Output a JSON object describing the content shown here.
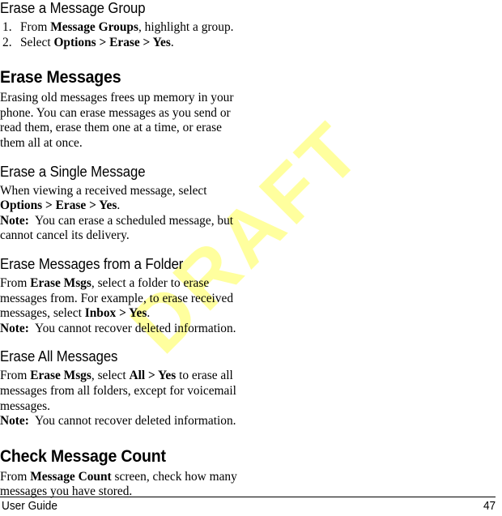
{
  "page": {
    "watermark": "DRAFT",
    "watermark_color": "#ffff9e",
    "background_color": "#ffffff",
    "text_color": "#000000"
  },
  "sections": [
    {
      "id": "erase-a-message-group",
      "heading": "Erase a Message Group",
      "steps": [
        {
          "number": "1.",
          "pre": "From ",
          "bold1": "Message Groups",
          "post": ", highlight a group."
        },
        {
          "number": "2.",
          "pre": "Select ",
          "bold1": "Options > Erase > Yes",
          "post": "."
        }
      ]
    },
    {
      "id": "erase-messages",
      "heading": "Erase Messages",
      "intro": "Erasing old messages frees up memory in your phone. You can erase messages as you send or read them, erase them one at a time, or erase them all at once."
    },
    {
      "id": "erase-a-single-message",
      "heading": "Erase a Single Message",
      "body_pre": "When viewing a received message, select ",
      "body_bold": "Options > Erase > Yes",
      "body_post": ".",
      "note_label": "Note:",
      "note_text": "You can erase a scheduled message, but cannot cancel its delivery."
    },
    {
      "id": "erase-messages-from-a-folder",
      "heading": "Erase Messages from a Folder",
      "body_pre": "From ",
      "body_bold1": "Erase Msgs",
      "body_mid": ", select a folder to erase messages from. For example, to erase received messages, select ",
      "body_bold2": "Inbox > Yes",
      "body_post": ".",
      "note_label": "Note:",
      "note_text": "You cannot recover deleted information."
    },
    {
      "id": "erase-all-messages",
      "heading": "Erase All Messages",
      "body_pre": "From ",
      "body_bold1": "Erase Msgs",
      "body_mid": ", select ",
      "body_bold2": "All > Yes",
      "body_post": " to erase all messages from all folders, except for voicemail messages.",
      "note_label": "Note:",
      "note_text": "You cannot recover deleted information."
    },
    {
      "id": "check-message-count",
      "heading": "Check Message Count",
      "body_pre": "From ",
      "body_bold": "Message Count",
      "body_post": " screen, check how many messages you have stored."
    }
  ],
  "footer": {
    "left": "User Guide",
    "page_number": "47"
  }
}
